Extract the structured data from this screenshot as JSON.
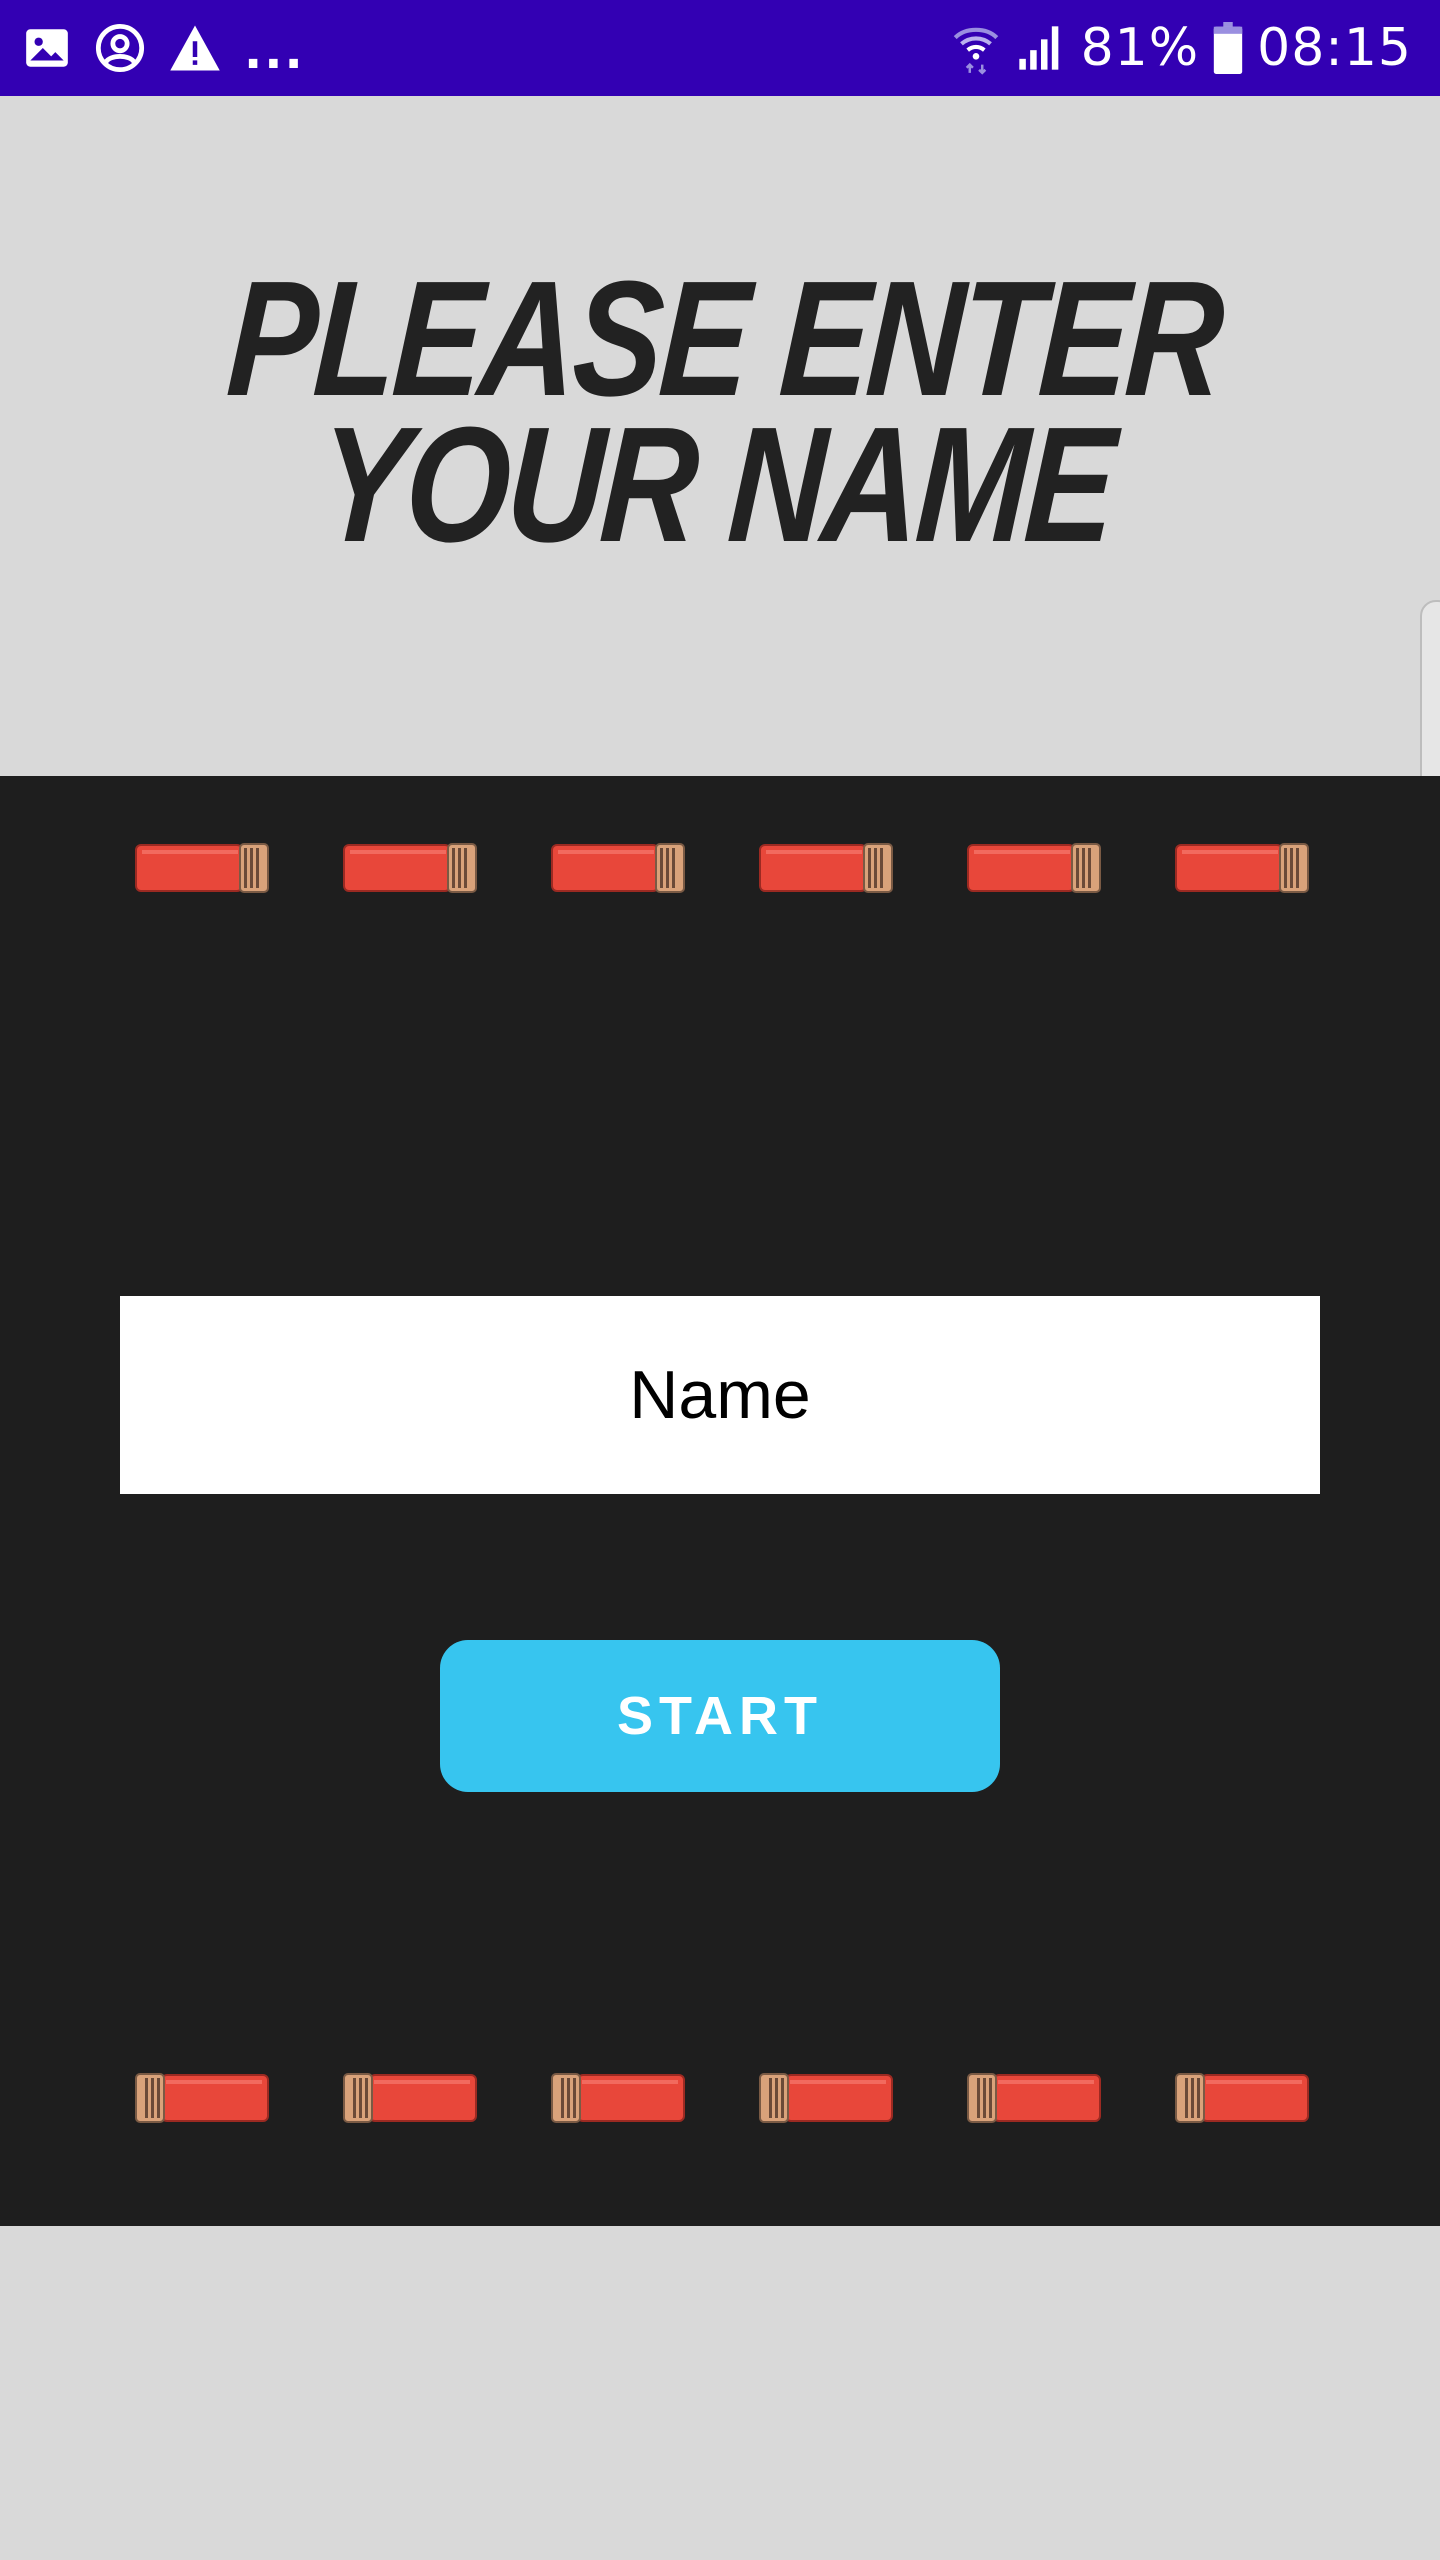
{
  "status_bar": {
    "left_icons": [
      "image-icon",
      "account-circle-icon",
      "warning-icon"
    ],
    "overflow": "...",
    "right_icons": [
      "wifi-icon",
      "signal-icon",
      "battery-icon"
    ],
    "battery": "81%",
    "time": "08:15",
    "background": "#3300b3"
  },
  "title": {
    "line1": "PLEASE ENTER",
    "line2": "YOUR NAME"
  },
  "form": {
    "name_placeholder": "Name",
    "name_value": "",
    "start_label": "START"
  },
  "shells": {
    "top_row_count": 6,
    "bottom_row_count": 6,
    "shell_color": "#e8473a",
    "brass_color": "#d9a27a"
  },
  "colors": {
    "page_background": "#d9d9d9",
    "panel_background": "#1e1e1e",
    "accent": "#37c5ef",
    "title_text": "#222222"
  }
}
